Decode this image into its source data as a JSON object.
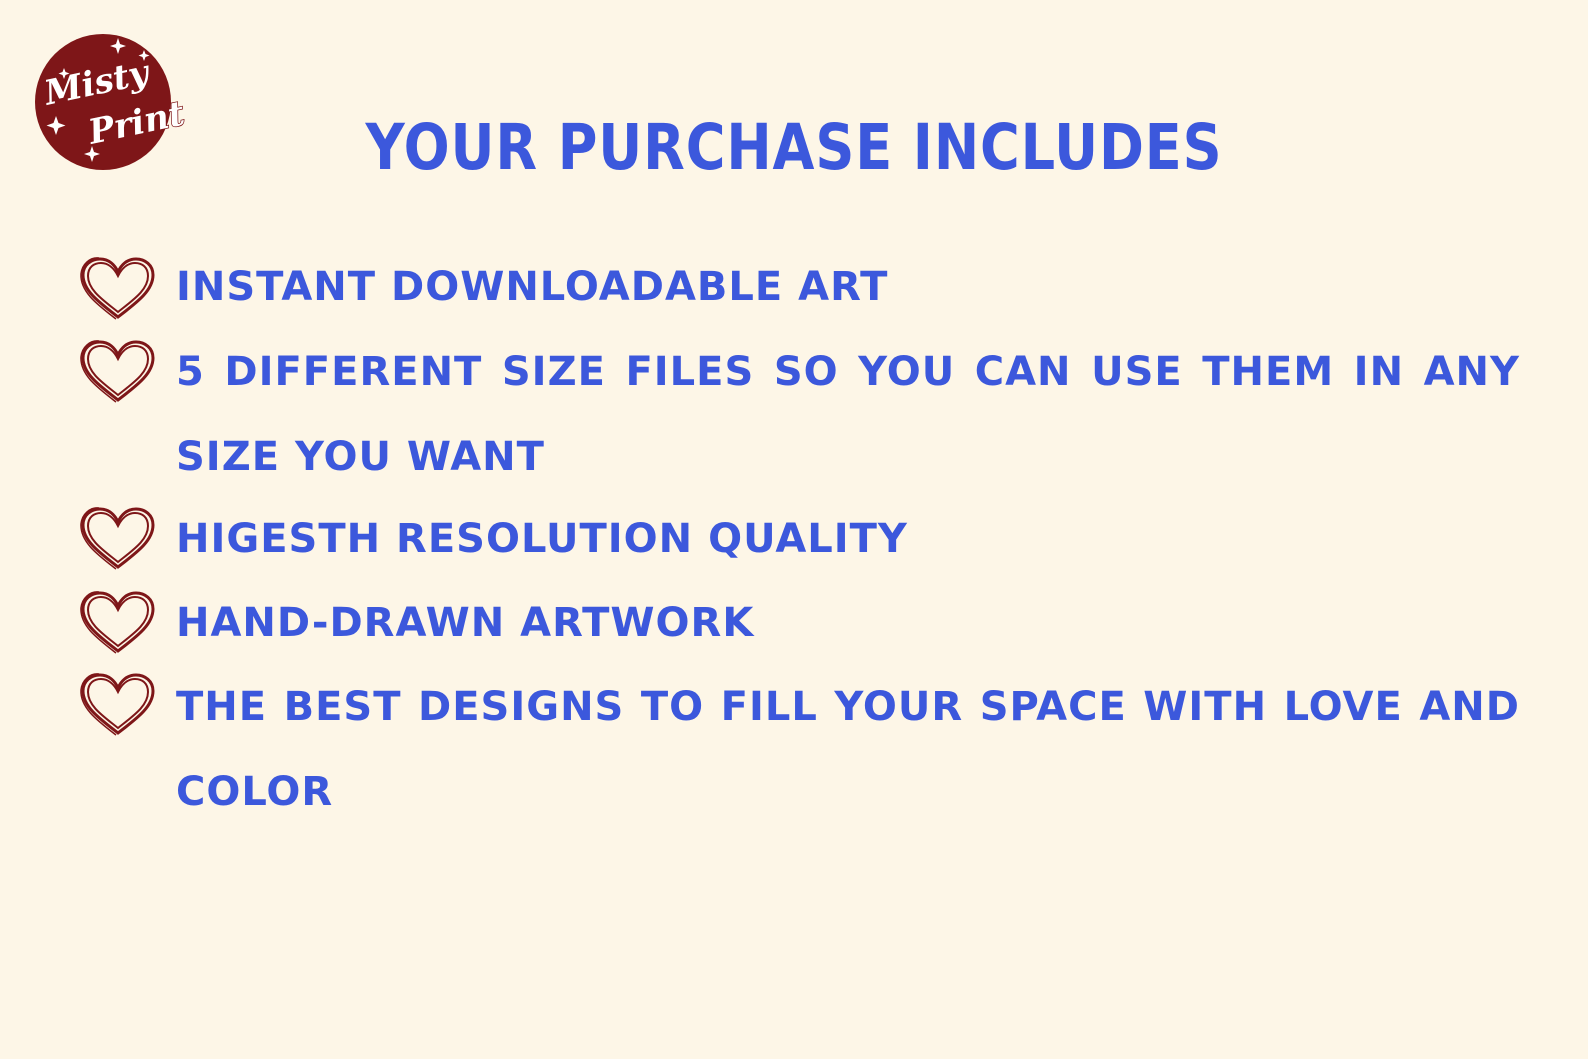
{
  "brand": {
    "logo_word_1": "Misty",
    "logo_word_2": "Print",
    "logo_color": "#7E1618"
  },
  "title": "YOUR PURCHASE INCLUDES",
  "items": [
    {
      "text": "INSTANT DOWNLOADABLE ART",
      "icon": "heart-icon"
    },
    {
      "text": "5 DIFFERENT SIZE FILES SO YOU CAN USE THEM IN ANY SIZE YOU WANT",
      "icon": "heart-icon"
    },
    {
      "text": "HIGESTH RESOLUTION QUALITY",
      "icon": "heart-icon"
    },
    {
      "text": "HAND-DRAWN ARTWORK",
      "icon": "heart-icon"
    },
    {
      "text": "THE BEST DESIGNS TO FILL YOUR SPACE WITH LOVE AND COLOR",
      "icon": "heart-icon"
    }
  ],
  "colors": {
    "background": "#FDF6E7",
    "text": "#3C58DC",
    "accent": "#7E1618"
  }
}
